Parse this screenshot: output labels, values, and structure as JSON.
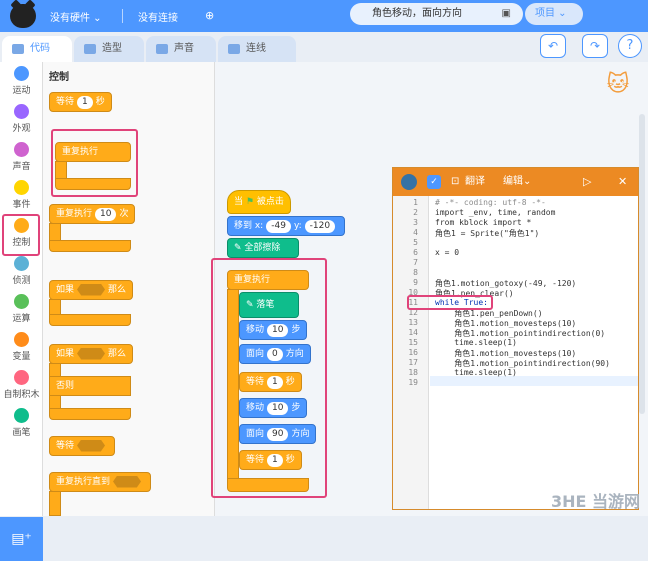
{
  "toolbar": {
    "hardware": "没有硬件",
    "connect": "没有连接",
    "project_title": "角色移动，面向方向",
    "project_menu": "项目"
  },
  "tabs": [
    {
      "label": "代码"
    },
    {
      "label": "造型"
    },
    {
      "label": "声音"
    },
    {
      "label": "连线"
    }
  ],
  "categories": [
    {
      "label": "运动",
      "color": "#4c97ff"
    },
    {
      "label": "外观",
      "color": "#9966ff"
    },
    {
      "label": "声音",
      "color": "#cf63cf"
    },
    {
      "label": "事件",
      "color": "#ffd500"
    },
    {
      "label": "控制",
      "color": "#ffab19"
    },
    {
      "label": "侦测",
      "color": "#5cb1d6"
    },
    {
      "label": "运算",
      "color": "#59c059"
    },
    {
      "label": "变量",
      "color": "#ff8c1a"
    },
    {
      "label": "自制积木",
      "color": "#ff6680"
    },
    {
      "label": "画笔",
      "color": "#0fbd8c"
    }
  ],
  "palette": {
    "title": "控制",
    "wait": "等待",
    "wait_num": "1",
    "seconds": "秒",
    "forever": "重复执行",
    "repeat": "重复执行",
    "repeat_num": "10",
    "times": "次",
    "if": "如果",
    "then": "那么",
    "else": "否则",
    "wait_until": "等待",
    "repeat_until": "重复执行直到"
  },
  "script": {
    "when_flag": "当",
    "clicked": "被点击",
    "goto": "移到 x:",
    "x": "-49",
    "y_label": "y:",
    "y": "-120",
    "clear": "全部擦除",
    "forever": "重复执行",
    "pen_down": "落笔",
    "move": "移动",
    "move_num": "10",
    "steps": "步",
    "point": "面向",
    "dir0": "0",
    "direction": "方向",
    "wait": "等待",
    "wait_num": "1",
    "sec": "秒",
    "dir90": "90"
  },
  "code_panel": {
    "translate": "翻译",
    "edit": "编辑",
    "lines": [
      "# -*- coding: utf-8 -*-",
      "import _env, time, random",
      "from kblock import *",
      "角色1 = Sprite(\"角色1\")",
      "",
      "x = 0",
      "",
      "",
      "角色1.motion_gotoxy(-49, -120)",
      "角色1.pen_clear()",
      "while True:",
      "    角色1.pen_penDown()",
      "    角色1.motion_movesteps(10)",
      "    角色1.motion_pointindirection(0)",
      "    time.sleep(1)",
      "    角色1.motion_movesteps(10)",
      "    角色1.motion_pointindirection(90)",
      "    time.sleep(1)",
      ""
    ],
    "line_numbers": [
      "1",
      "2",
      "3",
      "4",
      "5",
      "6",
      "7",
      "8",
      "9",
      "10",
      "11",
      "12",
      "13",
      "14",
      "15",
      "16",
      "17",
      "18",
      "19"
    ]
  },
  "watermark": "3HE 当游网"
}
